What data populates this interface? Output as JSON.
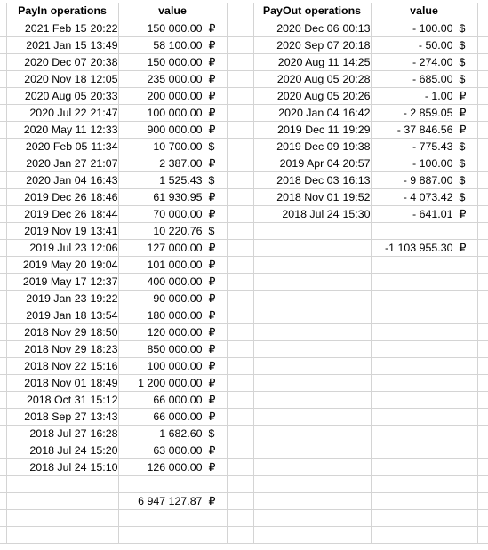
{
  "sheet": {
    "columns": {
      "payin_header": "PayIn operations",
      "payin_value_header": "value",
      "payout_header": "PayOut operations",
      "payout_value_header": "value"
    },
    "currency_symbols": {
      "rub": "₽",
      "usd": "$"
    },
    "grid_color": "#d4d4d4",
    "text_color": "#000000",
    "payin_rows": [
      {
        "date": "2021 Feb 15",
        "time": "20:22",
        "amount": "150 000.00",
        "currency": "₽"
      },
      {
        "date": "2021 Jan 15",
        "time": "13:49",
        "amount": "58 100.00",
        "currency": "₽"
      },
      {
        "date": "2020 Dec 07",
        "time": "20:38",
        "amount": "150 000.00",
        "currency": "₽"
      },
      {
        "date": "2020 Nov 18",
        "time": "12:05",
        "amount": "235 000.00",
        "currency": "₽"
      },
      {
        "date": "2020 Aug 05",
        "time": "20:33",
        "amount": "200 000.00",
        "currency": "₽"
      },
      {
        "date": "2020 Jul 22",
        "time": "21:47",
        "amount": "100 000.00",
        "currency": "₽"
      },
      {
        "date": "2020 May 11",
        "time": "12:33",
        "amount": "900 000.00",
        "currency": "₽"
      },
      {
        "date": "2020 Feb 05",
        "time": "11:34",
        "amount": "10 700.00",
        "currency": "$"
      },
      {
        "date": "2020 Jan 27",
        "time": "21:07",
        "amount": "2 387.00",
        "currency": "₽"
      },
      {
        "date": "2020 Jan 04",
        "time": "16:43",
        "amount": "1 525.43",
        "currency": "$"
      },
      {
        "date": "2019 Dec 26",
        "time": "18:46",
        "amount": "61 930.95",
        "currency": "₽"
      },
      {
        "date": "2019 Dec 26",
        "time": "18:44",
        "amount": "70 000.00",
        "currency": "₽"
      },
      {
        "date": "2019 Nov 19",
        "time": "13:41",
        "amount": "10 220.76",
        "currency": "$"
      },
      {
        "date": "2019 Jul 23",
        "time": "12:06",
        "amount": "127 000.00",
        "currency": "₽"
      },
      {
        "date": "2019 May 20",
        "time": "19:04",
        "amount": "101 000.00",
        "currency": "₽"
      },
      {
        "date": "2019 May 17",
        "time": "12:37",
        "amount": "400 000.00",
        "currency": "₽"
      },
      {
        "date": "2019 Jan 23",
        "time": "19:22",
        "amount": "90 000.00",
        "currency": "₽"
      },
      {
        "date": "2019 Jan 18",
        "time": "13:54",
        "amount": "180 000.00",
        "currency": "₽"
      },
      {
        "date": "2018 Nov 29",
        "time": "18:50",
        "amount": "120 000.00",
        "currency": "₽"
      },
      {
        "date": "2018 Nov 29",
        "time": "18:23",
        "amount": "850 000.00",
        "currency": "₽"
      },
      {
        "date": "2018 Nov 22",
        "time": "15:16",
        "amount": "100 000.00",
        "currency": "₽"
      },
      {
        "date": "2018 Nov 01",
        "time": "18:49",
        "amount": "1 200 000.00",
        "currency": "₽"
      },
      {
        "date": "2018 Oct 31",
        "time": "15:12",
        "amount": "66 000.00",
        "currency": "₽"
      },
      {
        "date": "2018 Sep 27",
        "time": "13:43",
        "amount": "66 000.00",
        "currency": "₽"
      },
      {
        "date": "2018 Jul 27",
        "time": "16:28",
        "amount": "1 682.60",
        "currency": "$"
      },
      {
        "date": "2018 Jul 24",
        "time": "15:20",
        "amount": "63 000.00",
        "currency": "₽"
      },
      {
        "date": "2018 Jul 24",
        "time": "15:10",
        "amount": "126 000.00",
        "currency": "₽"
      }
    ],
    "payin_total": {
      "amount": "6 947 127.87",
      "currency": "₽",
      "row_index": 29
    },
    "payout_rows": [
      {
        "date": "2020 Dec 06",
        "time": "00:13",
        "amount": "-  100.00",
        "currency": "$"
      },
      {
        "date": "2020 Sep 07",
        "time": "20:18",
        "amount": "-  50.00",
        "currency": "$"
      },
      {
        "date": "2020 Aug 11",
        "time": "14:25",
        "amount": "-  274.00",
        "currency": "$"
      },
      {
        "date": "2020 Aug 05",
        "time": "20:28",
        "amount": "-  685.00",
        "currency": "$"
      },
      {
        "date": "2020 Aug 05",
        "time": "20:26",
        "amount": "-  1.00",
        "currency": "₽"
      },
      {
        "date": "2020 Jan 04",
        "time": "16:42",
        "amount": "- 2 859.05",
        "currency": "₽"
      },
      {
        "date": "2019 Dec 11",
        "time": "19:29",
        "amount": "- 37 846.56",
        "currency": "₽"
      },
      {
        "date": "2019 Dec 09",
        "time": "19:38",
        "amount": "-  775.43",
        "currency": "$"
      },
      {
        "date": "2019 Apr 04",
        "time": "20:57",
        "amount": "-  100.00",
        "currency": "$"
      },
      {
        "date": "2018 Dec 03",
        "time": "16:13",
        "amount": "- 9 887.00",
        "currency": "$"
      },
      {
        "date": "2018 Nov 01",
        "time": "19:52",
        "amount": "- 4 073.42",
        "currency": "$"
      },
      {
        "date": "2018 Jul 24",
        "time": "15:30",
        "amount": "-  641.01",
        "currency": "₽"
      }
    ],
    "payout_total": {
      "amount": "-1 103 955.30",
      "currency": "₽",
      "row_index": 14
    },
    "total_rows": 32
  }
}
